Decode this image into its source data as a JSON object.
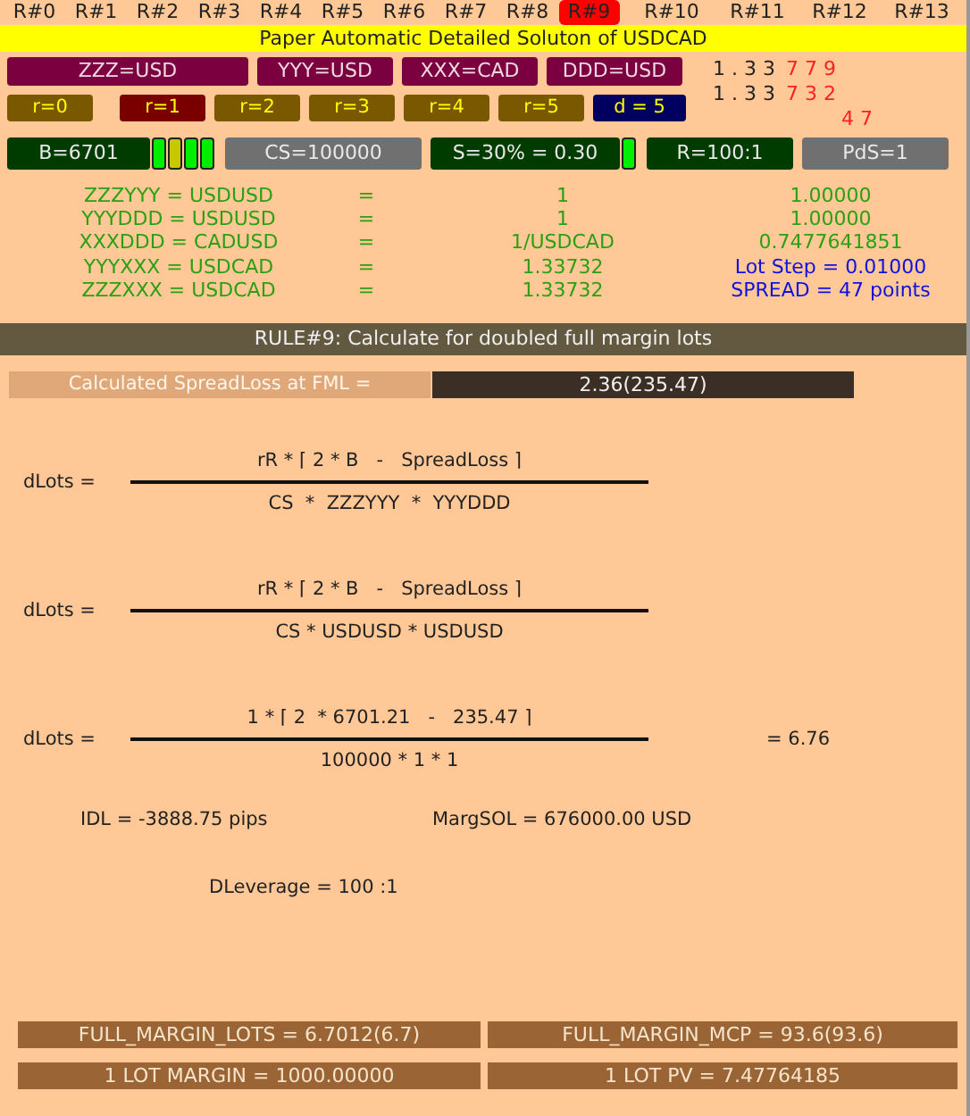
{
  "tabs": [
    {
      "label": "R#0",
      "selected": false
    },
    {
      "label": "R#1",
      "selected": false
    },
    {
      "label": "R#2",
      "selected": false
    },
    {
      "label": "R#3",
      "selected": false
    },
    {
      "label": "R#4",
      "selected": false
    },
    {
      "label": "R#5",
      "selected": false
    },
    {
      "label": "R#6",
      "selected": false
    },
    {
      "label": "R#7",
      "selected": false
    },
    {
      "label": "R#8",
      "selected": false
    },
    {
      "label": "R#9",
      "selected": true
    },
    {
      "label": "R#10",
      "selected": false
    },
    {
      "label": "R#11",
      "selected": false
    },
    {
      "label": "R#12",
      "selected": false
    },
    {
      "label": "R#13",
      "selected": false
    }
  ],
  "title": "Paper Automatic Detailed Soluton of USDCAD",
  "currencies": [
    "ZZZ=USD",
    "YYY=USD",
    "XXX=CAD",
    "DDD=USD"
  ],
  "prices": [
    {
      "base": "1 . 3 3",
      "tail": "7 7 9"
    },
    {
      "base": "1 . 3 3",
      "tail": "7 3 2"
    }
  ],
  "spread_digits": "4 7",
  "r_buttons": [
    {
      "label": "r=0",
      "color": "#7a5800"
    },
    {
      "label": "r=1",
      "color": "#7a0000"
    },
    {
      "label": "r=2",
      "color": "#7a5800"
    },
    {
      "label": "r=3",
      "color": "#7a5800"
    },
    {
      "label": "r=4",
      "color": "#7a5800"
    },
    {
      "label": "r=5",
      "color": "#7a5800"
    },
    {
      "label": "d = 5",
      "color": "#00005e"
    }
  ],
  "indicators": [
    {
      "label": "B=6701",
      "color": "#003c00",
      "lights": [
        {
          "color": "#00ee00"
        },
        {
          "color": "#c8c800"
        },
        {
          "color": "#00ee00"
        },
        {
          "color": "#00ee00"
        }
      ]
    },
    {
      "label": "CS=100000",
      "color": "#707070"
    },
    {
      "label": "S=30% = 0.30",
      "color": "#003c00",
      "lights": [
        {
          "color": "#00ee00"
        }
      ]
    },
    {
      "label": "R=100:1",
      "color": "#003c00"
    },
    {
      "label": "PdS=1",
      "color": "#707070"
    }
  ],
  "pairs": [
    {
      "name": "ZZZYYY = USDUSD",
      "eq": "=",
      "formula": "1",
      "value": "1.00000",
      "note": false
    },
    {
      "name": "YYYDDD = USDUSD",
      "eq": "=",
      "formula": "1",
      "value": "1.00000",
      "note": false
    },
    {
      "name": "XXXDDD = CADUSD",
      "eq": "=",
      "formula": "1/USDCAD",
      "value": "0.7477641851",
      "note": false
    },
    {
      "name": "YYYXXX = USDCAD",
      "eq": "=",
      "formula": "1.33732",
      "value": "Lot Step = 0.01000",
      "note": true
    },
    {
      "name": "ZZZXXX = USDCAD",
      "eq": "=",
      "formula": "1.33732",
      "value": "SPREAD = 47 points",
      "note": true
    }
  ],
  "rule": "RULE#9: Calculate for doubled full margin lots",
  "spread_loss": {
    "label": "Calculated SpreadLoss at FML =",
    "value": "2.36(235.47)"
  },
  "formulas": [
    {
      "label": "dLots =",
      "numerator": "rR * ⌈ 2 * B   -   SpreadLoss ⌉",
      "denominator": "CS  *  ZZZYYY  *  YYYDDD"
    },
    {
      "label": "dLots =",
      "numerator": "rR * ⌈ 2 * B   -   SpreadLoss ⌉",
      "denominator": "CS * USDUSD * USDUSD"
    },
    {
      "label": "dLots =",
      "numerator": "1 * ⌈ 2  * 6701.21   -   235.47 ⌉",
      "denominator": "100000 * 1 * 1",
      "result": "= 6.76"
    }
  ],
  "idl": "IDL = -3888.75 pips",
  "margsol": "MargSOL = 676000.00 USD",
  "dleverage": "DLeverage = 100 :1",
  "summary": [
    "FULL_MARGIN_LOTS = 6.7012(6.7)",
    "FULL_MARGIN_MCP = 93.6(93.6)",
    "1 LOT MARGIN = 1000.00000",
    "1 LOT PV = 7.47764185"
  ]
}
